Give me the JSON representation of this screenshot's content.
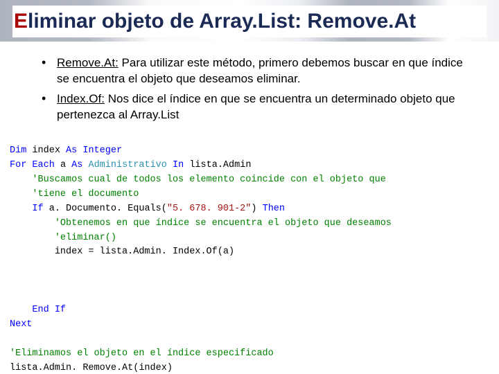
{
  "title": {
    "red": "E",
    "rest": "liminar objeto de Array.List: Remove.At"
  },
  "bullets": [
    {
      "term": "Remove.At:",
      "body": " Para utilizar este método, primero debemos buscar en que índice se encuentra el objeto que deseamos eliminar."
    },
    {
      "term": "Index.Of:",
      "body": " Nos dice el índice en que se encuentra un determinado objeto que pertenezca al Array.List"
    }
  ],
  "code": {
    "l1": {
      "a": "Dim",
      "b": "index",
      "c": "As",
      "d": "Integer"
    },
    "l2": {
      "a": "For",
      "b": "Each",
      "c": "a",
      "d": "As",
      "e": "Administrativo",
      "f": "In",
      "g": "lista.Admin"
    },
    "l3": "'Buscamos cual de todos los elemento coincide con el objeto que",
    "l4": "'tiene el documento",
    "l5": {
      "a": "If",
      "b": "a. Documento. Equals(",
      "c": "\"5. 678. 901-2\"",
      "d": ")",
      "e": "Then"
    },
    "l6": "'Obtenemos en que índice se encuentra el objeto que deseamos",
    "l7": "'eliminar()",
    "l8": "index = lista.Admin. Index.Of(a)",
    "l9": {
      "a": "End",
      "b": "If"
    },
    "l10": "Next",
    "l11": "'Eliminamos el objeto en el índice especificado",
    "l12": "lista.Admin. Remove.At(index)"
  }
}
